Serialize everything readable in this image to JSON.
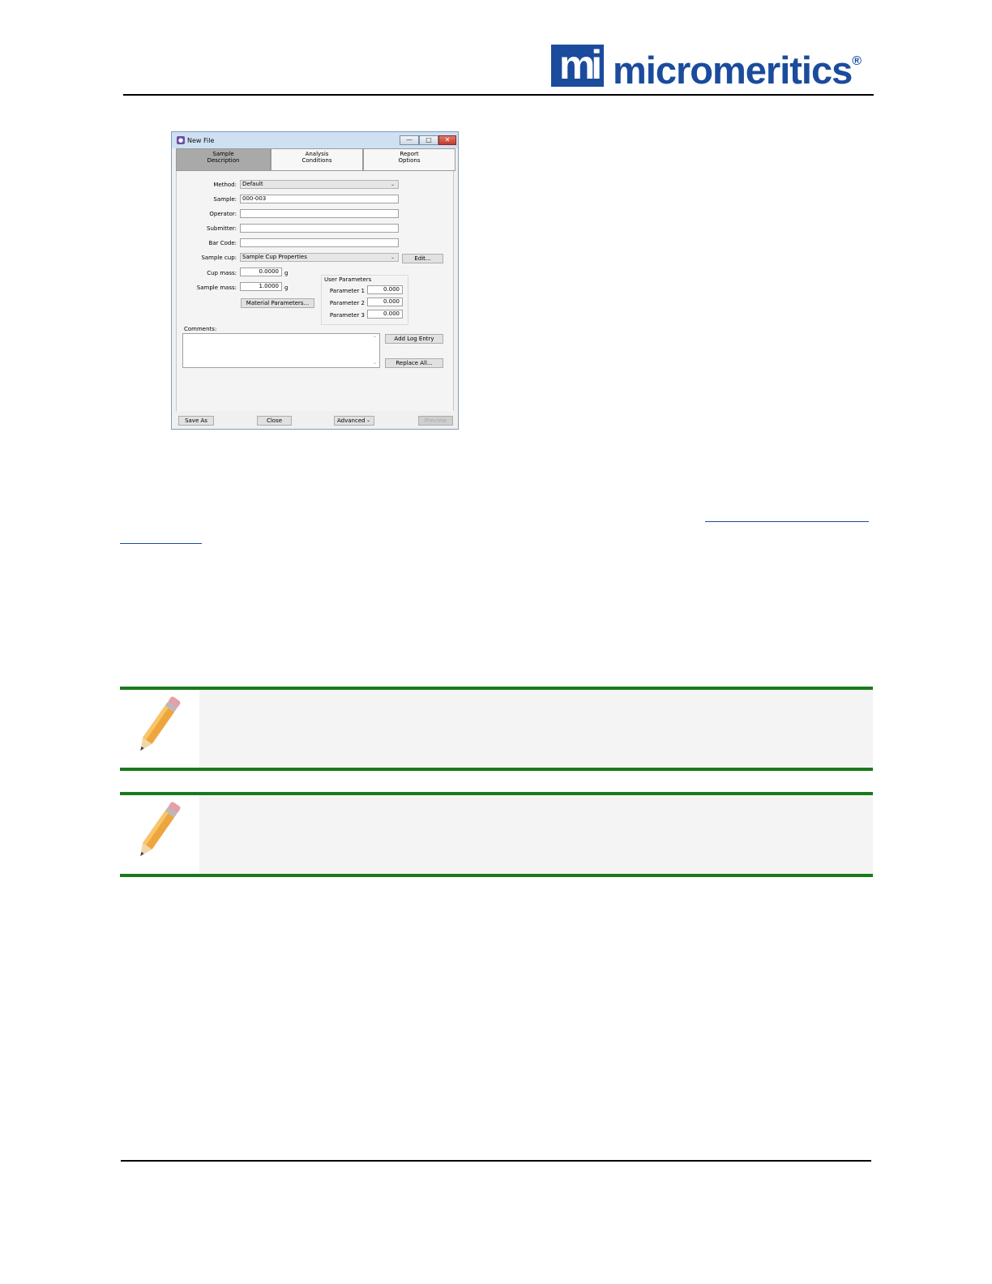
{
  "header": {
    "logo_mark": "mi",
    "logo_text": "micromeritics",
    "logo_reg": "®"
  },
  "dialog": {
    "title": "New File",
    "titlebar_buttons": {
      "minimize": "—",
      "maximize": "□",
      "close": "✕"
    },
    "tabs": [
      {
        "line1": "Sample",
        "line2": "Description",
        "active": true
      },
      {
        "line1": "Analysis",
        "line2": "Conditions",
        "active": false
      },
      {
        "line1": "Report",
        "line2": "Options",
        "active": false
      }
    ],
    "form": {
      "method_label": "Method:",
      "method_value": "Default",
      "sample_label": "Sample:",
      "sample_value": "000-003",
      "operator_label": "Operator:",
      "operator_value": "",
      "submitter_label": "Submitter:",
      "submitter_value": "",
      "barcode_label": "Bar Code:",
      "barcode_value": "",
      "sample_cup_label": "Sample cup:",
      "sample_cup_value": "Sample Cup Properties",
      "edit_button": "Edit...",
      "cup_mass_label": "Cup mass:",
      "cup_mass_value": "0.0000",
      "cup_mass_unit": "g",
      "sample_mass_label": "Sample mass:",
      "sample_mass_value": "1.0000",
      "sample_mass_unit": "g",
      "material_parameters_button": "Material Parameters..."
    },
    "user_parameters": {
      "title": "User Parameters",
      "items": [
        {
          "label": "Parameter 1",
          "value": "0.000"
        },
        {
          "label": "Parameter 2",
          "value": "0.000"
        },
        {
          "label": "Parameter 3",
          "value": "0.000"
        }
      ]
    },
    "comments": {
      "label": "Comments:",
      "value": "",
      "add_log_entry_button": "Add Log Entry",
      "replace_all_button": "Replace All..."
    },
    "footer": {
      "save_as_button": "Save As",
      "close_button": "Close",
      "advanced_button": "Advanced",
      "preview_button": "Preview"
    },
    "icons": {
      "dropdown": "chevron-down-icon",
      "scroll_up": "chevron-up-icon"
    }
  },
  "colors": {
    "brand_blue": "#1b4b9c",
    "note_green": "#1a7a1a",
    "pencil_orange": "#e8a33a"
  }
}
